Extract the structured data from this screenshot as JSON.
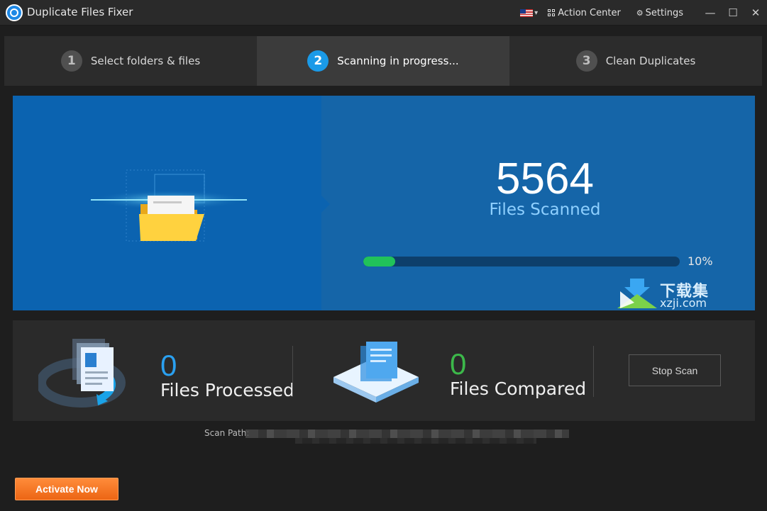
{
  "app": {
    "title": "Duplicate Files Fixer"
  },
  "titlebar": {
    "action_center_label": "Action Center",
    "settings_label": "Settings",
    "minimize_glyph": "—",
    "maximize_glyph": "☐",
    "close_glyph": "✕"
  },
  "steps": [
    {
      "number": "1",
      "label": "Select folders & files",
      "active": false
    },
    {
      "number": "2",
      "label": "Scanning in progress...",
      "active": true
    },
    {
      "number": "3",
      "label": "Clean Duplicates",
      "active": false
    }
  ],
  "scan": {
    "count": "5564",
    "caption": "Files Scanned",
    "progress_value": 0.1,
    "progress_label": "10%"
  },
  "stats": {
    "processed": {
      "value": "0",
      "label": "Files Processed",
      "color": "#2aa0f0"
    },
    "compared": {
      "value": "0",
      "label": "Files Compared",
      "color": "#3cb84a"
    }
  },
  "stop_button_label": "Stop Scan",
  "scan_path_label": "Scan Path:",
  "activate_button_label": "Activate Now",
  "watermark": {
    "cn": "下载集",
    "en": "xzji.com"
  },
  "colors": {
    "accent": "#1a9ae8",
    "progress": "#21c25a",
    "activate": "#ec6514"
  }
}
